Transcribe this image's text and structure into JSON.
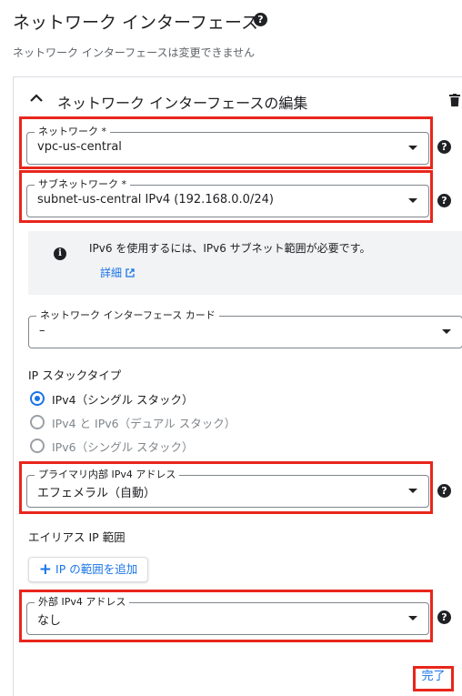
{
  "header": {
    "title": "ネットワーク インターフェース",
    "help_icon": "help-circle-icon",
    "subtitle": "ネットワーク インターフェースは変更できません"
  },
  "panel": {
    "collapse_icon": "chevron-up-icon",
    "title": "ネットワーク インターフェースの編集",
    "delete_icon": "trash-icon"
  },
  "network": {
    "label": "ネットワーク *",
    "value": "vpc-us-central"
  },
  "subnetwork": {
    "label": "サブネットワーク *",
    "value": "subnet-us-central IPv4 (192.168.0.0/24)"
  },
  "info": {
    "icon": "info-icon",
    "text": "IPv6 を使用するには、IPv6 サブネット範囲が必要です。",
    "link": "詳細",
    "link_icon": "external-link-icon"
  },
  "nic_card": {
    "label": "ネットワーク インターフェース カード",
    "value": "–"
  },
  "ip_stack": {
    "label": "IP スタックタイプ",
    "options": [
      {
        "label": "IPv4（シングル スタック）",
        "selected": true
      },
      {
        "label": "IPv4 と IPv6（デュアル スタック）",
        "selected": false
      },
      {
        "label": "IPv6（シングル スタック）",
        "selected": false
      }
    ]
  },
  "primary_internal_ip": {
    "label": "プライマリ内部 IPv4 アドレス",
    "value": "エフェメラル（自動）"
  },
  "alias_ip": {
    "label": "エイリアス IP 範囲",
    "add_button": "IP の範囲を追加"
  },
  "external_ip": {
    "label": "外部 IPv4 アドレス",
    "value": "なし"
  },
  "done_button": "完了",
  "colors": {
    "highlight": "#e8261c",
    "link": "#1a73e8",
    "radio_selected": "#1a73e8"
  }
}
